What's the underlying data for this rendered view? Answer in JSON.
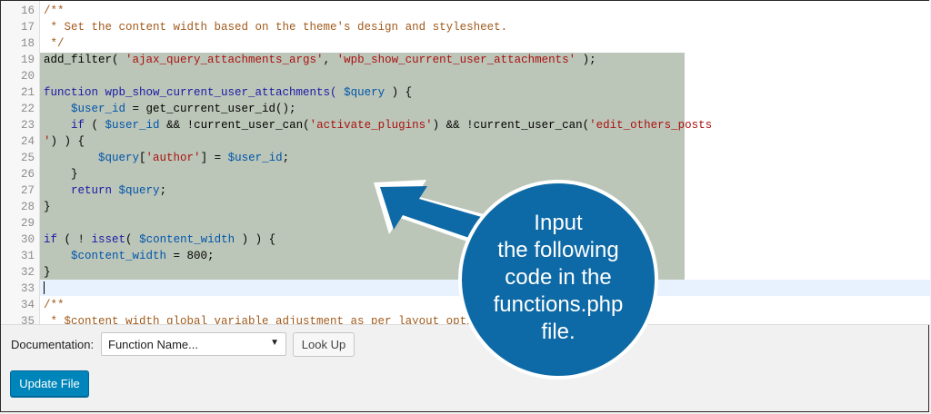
{
  "editor": {
    "lines": [
      {
        "num": "16",
        "segments": [
          {
            "t": "/**",
            "c": "comment"
          }
        ]
      },
      {
        "num": "17",
        "segments": [
          {
            "t": " * Set the content width based on the theme's design and stylesheet.",
            "c": "comment"
          }
        ]
      },
      {
        "num": "18",
        "segments": [
          {
            "t": " */",
            "c": "comment"
          }
        ]
      },
      {
        "num": "19",
        "segments": [
          {
            "t": "add_filter( ",
            "c": ""
          },
          {
            "t": "'ajax_query_attachments_args'",
            "c": "str"
          },
          {
            "t": ", ",
            "c": ""
          },
          {
            "t": "'wpb_show_current_user_attachments'",
            "c": "str"
          },
          {
            "t": " );",
            "c": ""
          }
        ]
      },
      {
        "num": "20",
        "segments": []
      },
      {
        "num": "21",
        "segments": [
          {
            "t": "function",
            "c": "kw"
          },
          {
            "t": " wpb_show_current_user_attachments( ",
            "c": "kw"
          },
          {
            "t": "$query",
            "c": "var"
          },
          {
            "t": " ) {",
            "c": ""
          }
        ]
      },
      {
        "num": "22",
        "segments": [
          {
            "t": "    ",
            "c": ""
          },
          {
            "t": "$user_id",
            "c": "var"
          },
          {
            "t": " = get_current_user_id();",
            "c": ""
          }
        ]
      },
      {
        "num": "23",
        "segments": [
          {
            "t": "    ",
            "c": ""
          },
          {
            "t": "if",
            "c": "kw"
          },
          {
            "t": " ( ",
            "c": ""
          },
          {
            "t": "$user_id",
            "c": "var"
          },
          {
            "t": " && !current_user_can(",
            "c": ""
          },
          {
            "t": "'activate_plugins'",
            "c": "str"
          },
          {
            "t": ") && !current_user_can(",
            "c": ""
          },
          {
            "t": "'edit_others_posts",
            "c": "str"
          }
        ]
      },
      {
        "num": "24",
        "segments": [
          {
            "t": "'",
            "c": "str"
          },
          {
            "t": ") ) {",
            "c": ""
          }
        ]
      },
      {
        "num": "25",
        "segments": [
          {
            "t": "        ",
            "c": ""
          },
          {
            "t": "$query",
            "c": "var"
          },
          {
            "t": "[",
            "c": ""
          },
          {
            "t": "'author'",
            "c": "str"
          },
          {
            "t": "] = ",
            "c": ""
          },
          {
            "t": "$user_id",
            "c": "var"
          },
          {
            "t": ";",
            "c": ""
          }
        ]
      },
      {
        "num": "26",
        "segments": [
          {
            "t": "    }",
            "c": ""
          }
        ]
      },
      {
        "num": "27",
        "segments": [
          {
            "t": "    ",
            "c": ""
          },
          {
            "t": "return",
            "c": "kw"
          },
          {
            "t": " ",
            "c": ""
          },
          {
            "t": "$query",
            "c": "var"
          },
          {
            "t": ";",
            "c": ""
          }
        ]
      },
      {
        "num": "28",
        "segments": [
          {
            "t": "}",
            "c": ""
          }
        ]
      },
      {
        "num": "29",
        "segments": []
      },
      {
        "num": "30",
        "segments": [
          {
            "t": "if",
            "c": "kw"
          },
          {
            "t": " ( ! ",
            "c": ""
          },
          {
            "t": "isset",
            "c": "kw"
          },
          {
            "t": "( ",
            "c": ""
          },
          {
            "t": "$content_width",
            "c": "var"
          },
          {
            "t": " ) ) {",
            "c": ""
          }
        ]
      },
      {
        "num": "31",
        "segments": [
          {
            "t": "    ",
            "c": ""
          },
          {
            "t": "$content_width",
            "c": "var"
          },
          {
            "t": " = 800;",
            "c": ""
          }
        ]
      },
      {
        "num": "32",
        "segments": [
          {
            "t": "}",
            "c": ""
          }
        ]
      },
      {
        "num": "33",
        "segments": []
      },
      {
        "num": "34",
        "segments": [
          {
            "t": "/**",
            "c": "comment"
          }
        ]
      },
      {
        "num": "35",
        "segments": [
          {
            "t": " * $content_width global variable adjustment as per layout option",
            "c": "comment"
          }
        ]
      }
    ]
  },
  "documentation": {
    "label": "Documentation:",
    "selected": "Function Name...",
    "arrow": "▼",
    "lookup_label": "Look Up"
  },
  "update_label": "Update File",
  "callout": {
    "lines": [
      "Input",
      "the following",
      "code in the",
      "functions.php",
      "file."
    ],
    "color": "#0e6aa6",
    "border": "#ffffff"
  }
}
